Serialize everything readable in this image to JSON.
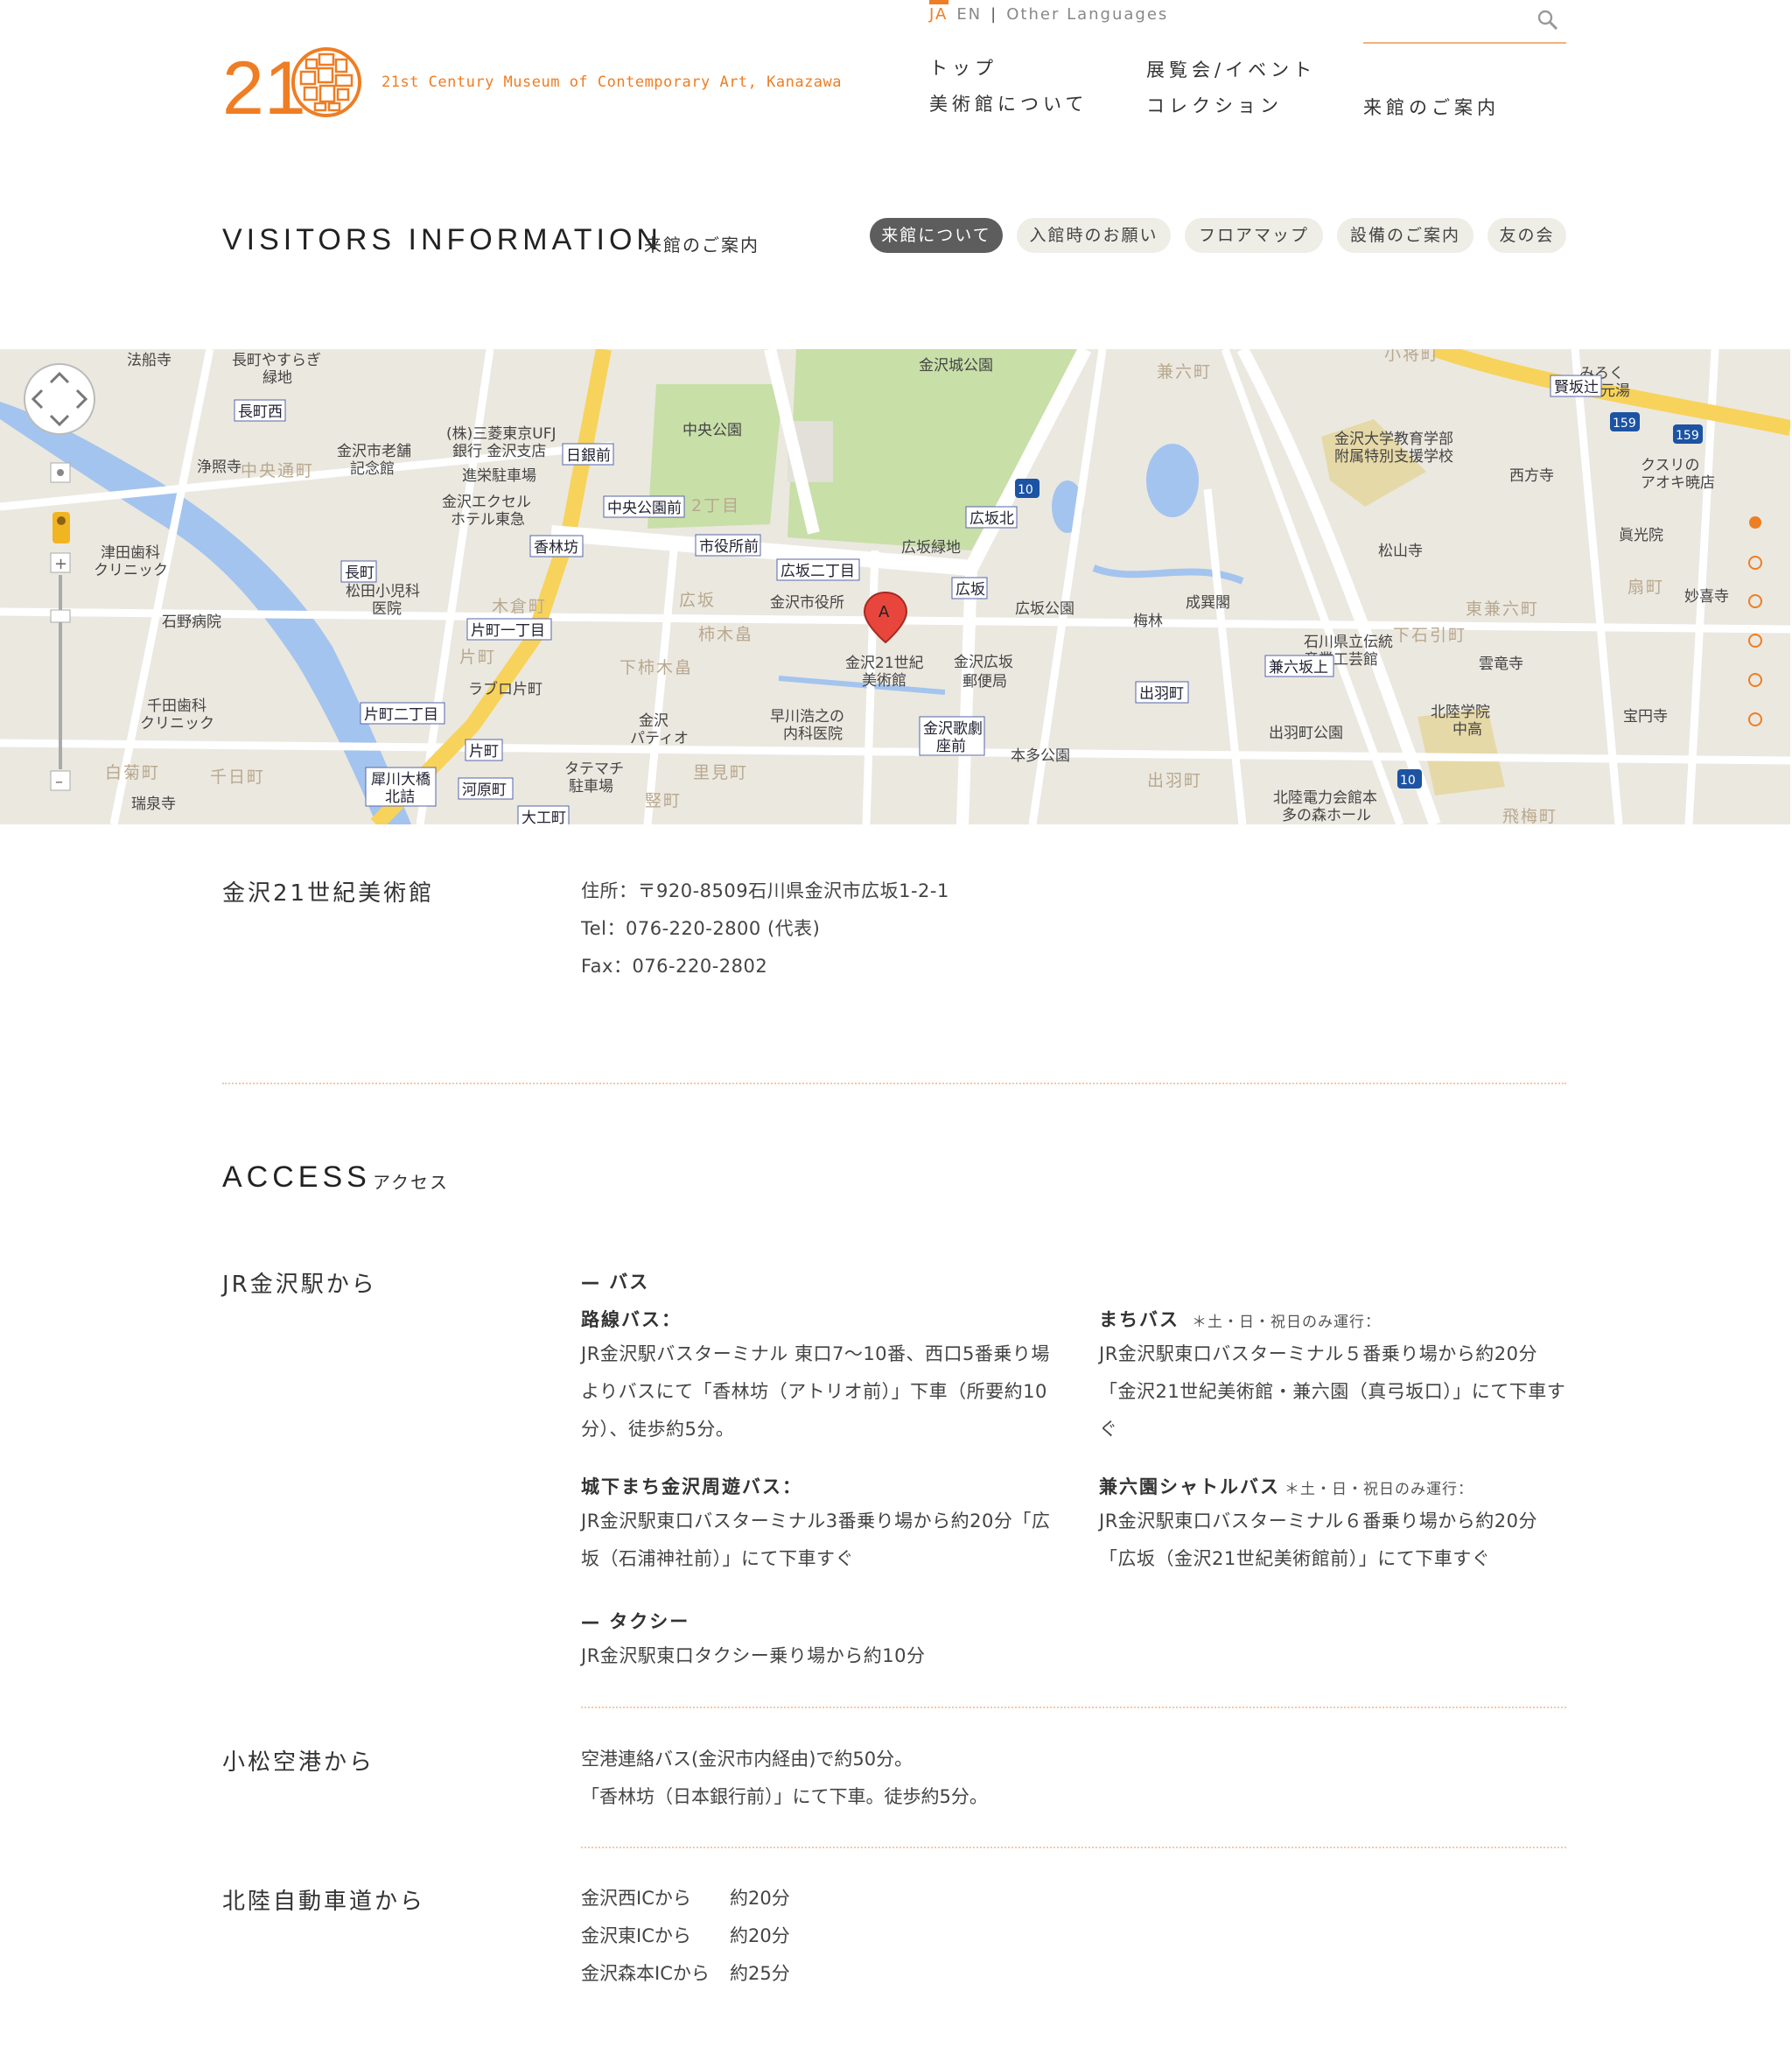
{
  "header": {
    "logo_text": "21st Century Museum of Contemporary Art, Kanazawa",
    "lang": {
      "ja": "JA",
      "en": "EN",
      "other": "Other Languages"
    },
    "search": {
      "placeholder": ""
    },
    "nav": [
      {
        "label": "トップ"
      },
      {
        "label": "美術館について"
      },
      {
        "label": "展覧会/イベント"
      },
      {
        "label": "コレクション"
      },
      {
        "label": "来館のご案内"
      }
    ]
  },
  "page": {
    "title": "VISITORS INFORMATION",
    "subtitle": "来館のご案内",
    "subnav": [
      {
        "label": "来館について",
        "active": true
      },
      {
        "label": "入館時のお願い"
      },
      {
        "label": "フロアマップ"
      },
      {
        "label": "設備のご案内"
      },
      {
        "label": "友の会"
      }
    ]
  },
  "map": {
    "labels": {
      "museum": "金沢21世紀美術館",
      "park": "金沢城公園",
      "chuo_park": "中央公園",
      "hirosaka_green": "広坂緑地",
      "kenrokuen": "兼六町",
      "city_hall": "金沢市役所",
      "kanazawa_post": "金沢広坂郵便局",
      "kenrokuen_shita": "兼六坂上",
      "dewa": "出羽町",
      "katamachi": "片町",
      "korinbo": "香林坊",
      "hirosaka": "広坂",
      "marker": "A",
      "route_10": "10",
      "route_159": "159"
    }
  },
  "info": {
    "name": "金沢21世紀美術館",
    "address": "住所：〒920-8509石川県金沢市広坂1-2-1",
    "tel": "Tel：076-220-2800 (代表)",
    "fax": "Fax：076-220-2802"
  },
  "access": {
    "title": "ACCESS",
    "subtitle": "アクセス",
    "jr": {
      "label": "JR金沢駅から",
      "bus_header": "— バス",
      "rosen_title": "路線バス：",
      "rosen_text": "JR金沢駅バスターミナル 東口7〜10番、西口5番乗り場よりバスにて「香林坊（アトリオ前）」下車（所要約10分）、徒歩約5分。",
      "jokamachi_title": "城下まち金沢周遊バス：",
      "jokamachi_text": "JR金沢駅東口バスターミナル3番乗り場から約20分「広坂（石浦神社前）」にて下車すぐ",
      "machi_title": "まちバス",
      "machi_note": "＊土・日・祝日のみ運行：",
      "machi_text": "JR金沢駅東口バスターミナル５番乗り場から約20分「金沢21世紀美術館・兼六園（真弓坂口）」にて下車すぐ",
      "kenroku_title": "兼六園シャトルバス",
      "kenroku_note": "＊土・日・祝日のみ運行：",
      "kenroku_text": "JR金沢駅東口バスターミナル６番乗り場から約20分「広坂（金沢21世紀美術館前）」にて下車すぐ",
      "taxi_header": "— タクシー",
      "taxi_text": "JR金沢駅東口タクシー乗り場から約10分"
    },
    "airport": {
      "label": "小松空港から",
      "line1": "空港連絡バス(金沢市内経由)で約50分。",
      "line2": "「香林坊（日本銀行前）」にて下車。徒歩約5分。"
    },
    "highway": {
      "label": "北陸自動車道から",
      "rows": [
        {
          "from": "金沢西ICから",
          "time": "約20分"
        },
        {
          "from": "金沢東ICから",
          "time": "約20分"
        },
        {
          "from": "金沢森本ICから",
          "time": "約25分"
        }
      ]
    }
  },
  "colors": {
    "accent": "#ef7d23",
    "pill_bg": "#eeede6",
    "pill_active": "#5d5d5d"
  }
}
